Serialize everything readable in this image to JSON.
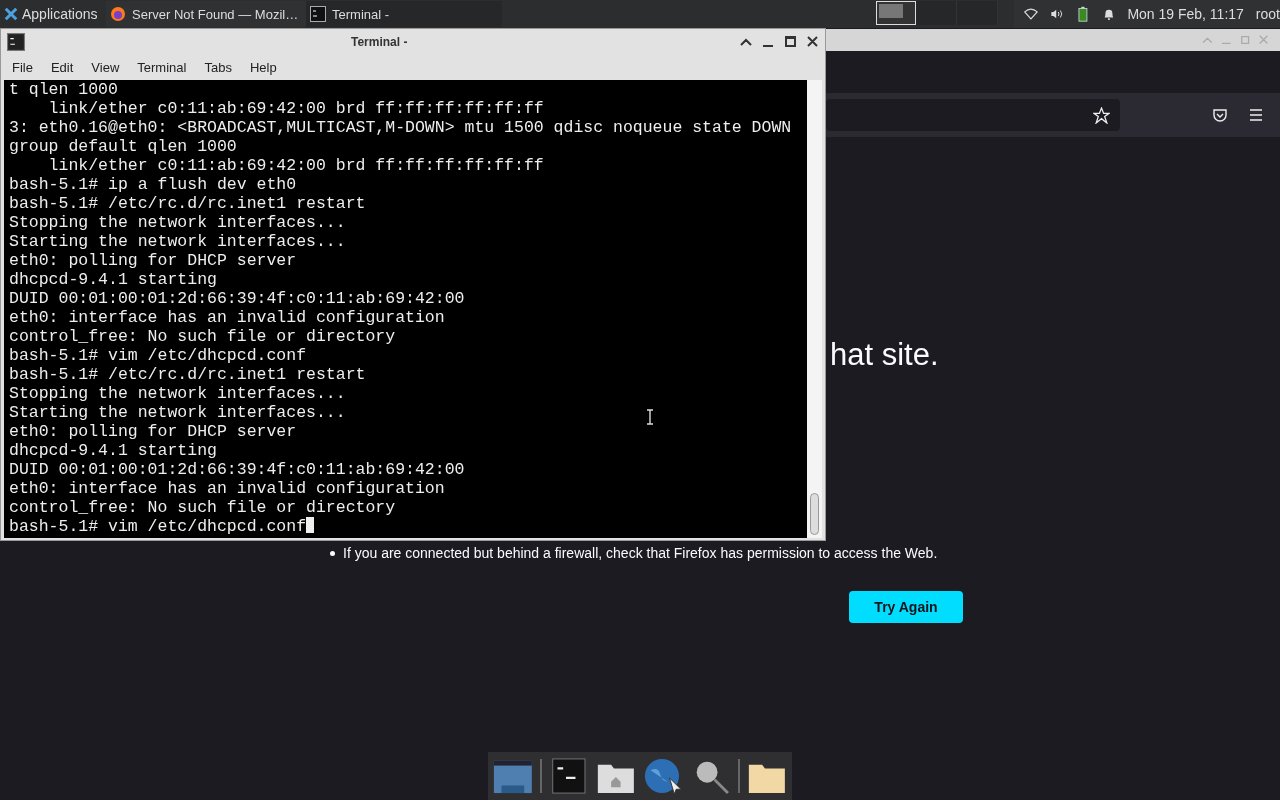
{
  "panel": {
    "menu_label": "Applications",
    "tasks": [
      {
        "label": "Server Not Found — Mozil…",
        "kind": "browser",
        "selected": false
      },
      {
        "label": "Terminal -",
        "kind": "terminal",
        "selected": true
      }
    ],
    "clock": "Mon 19 Feb, 11:17",
    "user": "root"
  },
  "browser": {
    "heading": "hat site.",
    "bullet": "If you are connected but behind a firewall, check that Firefox has permission to access the Web.",
    "button": "Try Again"
  },
  "terminal": {
    "title": "Terminal -",
    "menu": [
      "File",
      "Edit",
      "View",
      "Terminal",
      "Tabs",
      "Help"
    ],
    "lines": [
      "t qlen 1000",
      "    link/ether c0:11:ab:69:42:00 brd ff:ff:ff:ff:ff:ff",
      "3: eth0.16@eth0: <BROADCAST,MULTICAST,M-DOWN> mtu 1500 qdisc noqueue state DOWN",
      "group default qlen 1000",
      "    link/ether c0:11:ab:69:42:00 brd ff:ff:ff:ff:ff:ff",
      "bash-5.1# ip a flush dev eth0",
      "bash-5.1# /etc/rc.d/rc.inet1 restart",
      "Stopping the network interfaces...",
      "Starting the network interfaces...",
      "eth0: polling for DHCP server",
      "dhcpcd-9.4.1 starting",
      "DUID 00:01:00:01:2d:66:39:4f:c0:11:ab:69:42:00",
      "eth0: interface has an invalid configuration",
      "control_free: No such file or directory",
      "bash-5.1# vim /etc/dhcpcd.conf",
      "bash-5.1# /etc/rc.d/rc.inet1 restart",
      "Stopping the network interfaces...",
      "Starting the network interfaces...",
      "eth0: polling for DHCP server",
      "dhcpcd-9.4.1 starting",
      "DUID 00:01:00:01:2d:66:39:4f:c0:11:ab:69:42:00",
      "eth0: interface has an invalid configuration",
      "control_free: No such file or directory",
      "bash-5.1# vim /etc/dhcpcd.conf"
    ]
  },
  "dock": [
    {
      "kind": "desktop"
    },
    {
      "kind": "terminal"
    },
    {
      "kind": "home"
    },
    {
      "kind": "web"
    },
    {
      "kind": "search"
    },
    {
      "kind": "folder"
    }
  ]
}
